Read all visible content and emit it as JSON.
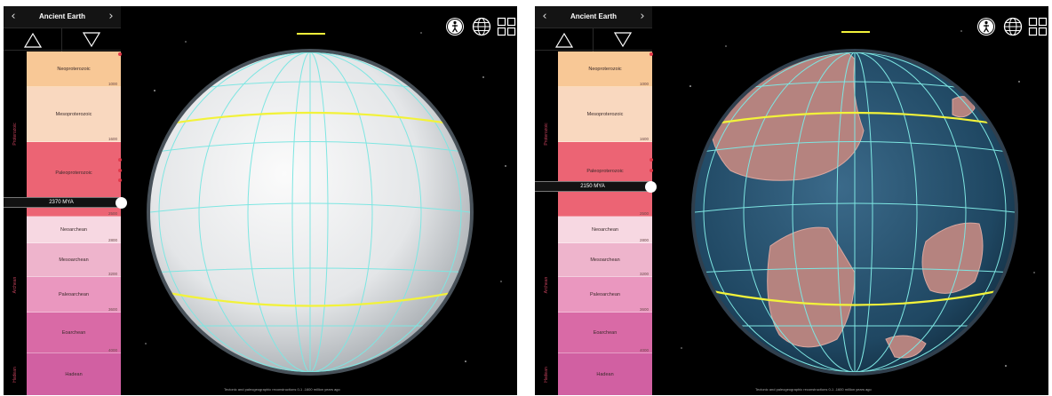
{
  "app": {
    "title": "Ancient Earth"
  },
  "nav": {
    "prev_icon": "‹",
    "next_icon": "›"
  },
  "stepper": {
    "up_icon": "triangle-up-icon",
    "down_icon": "triangle-down-icon"
  },
  "toolbar": {
    "icons": [
      "person-icon",
      "globe-grid-icon",
      "grid-layout-icon"
    ]
  },
  "colors": {
    "background": "#000000",
    "accent_yellow": "#f2f23a",
    "grid_cyan": "#7ee6e2",
    "eon_text": "#c0405a",
    "neoproterozoic": "#f8c896",
    "mesoproterozoic": "#f9d8bf",
    "paleoproterozoic": "#ec6474",
    "neoarchean": "#f7d8e2",
    "mesoarchean": "#eeb4cc",
    "paleoarchean": "#ea97bf",
    "eoarchean": "#d96aa6",
    "hadean": "#d160a2"
  },
  "timeline": {
    "eons": [
      {
        "name": "Proterozoic"
      },
      {
        "name": "Archean"
      },
      {
        "name": "Hadean"
      }
    ],
    "eras": [
      {
        "name": "Neoproterozoic",
        "color": "#f8c896"
      },
      {
        "name": "Mesoproterozoic",
        "color": "#f9d8bf"
      },
      {
        "name": "Paleoproterozoic",
        "color": "#ec6474"
      },
      {
        "name": "Neoarchean",
        "color": "#f7d8e2"
      },
      {
        "name": "Mesoarchean",
        "color": "#eeb4cc"
      },
      {
        "name": "Paleoarchean",
        "color": "#ea97bf"
      },
      {
        "name": "Eoarchean",
        "color": "#d96aa6"
      },
      {
        "name": "Hadean",
        "color": "#d160a2"
      }
    ],
    "ticks": [
      "1000",
      "1600",
      "2500",
      "2800",
      "3200",
      "3600",
      "4000"
    ]
  },
  "panels": [
    {
      "mya_label": "2370 MYA"
    },
    {
      "mya_label": "2150 MYA"
    }
  ],
  "footer": {
    "text": "Tectonic and paleogeographic reconstructions 0-1 -1600 million years ago"
  }
}
